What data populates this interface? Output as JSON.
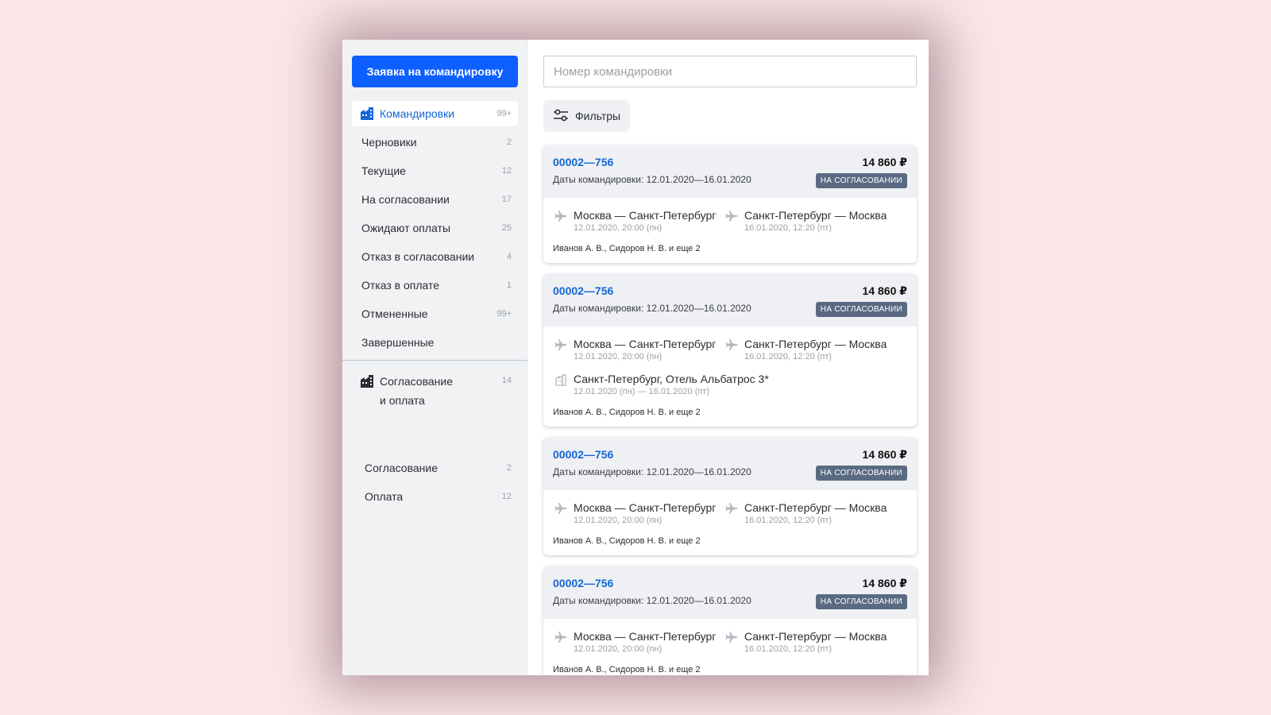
{
  "sidebar": {
    "new_trip_label": "Заявка на командировку",
    "items": [
      {
        "label": "Командировки",
        "count": "99+",
        "active": true
      },
      {
        "label": "Черновики",
        "count": "2"
      },
      {
        "label": "Текущие",
        "count": "12"
      },
      {
        "label": "На согласовании",
        "count": "17"
      },
      {
        "label": "Ожидают оплаты",
        "count": "25"
      },
      {
        "label": "Отказ в согласовании",
        "count": "4"
      },
      {
        "label": "Отказ в оплате",
        "count": "1"
      },
      {
        "label": "Отмененные",
        "count": "99+"
      },
      {
        "label": "Завершенные",
        "count": ""
      }
    ],
    "group": {
      "label_line1": "Согласование",
      "label_line2": "и оплата",
      "count": "14",
      "items": [
        {
          "label": "Согласование",
          "count": "2"
        },
        {
          "label": "Оплата",
          "count": "12"
        }
      ]
    }
  },
  "search": {
    "placeholder": "Номер командировки"
  },
  "filters_label": "Фильтры",
  "cards": [
    {
      "number": "00002—756",
      "dates": "Даты командировки: 12.01.2020—16.01.2020",
      "price": "14 860 ₽",
      "status": "НА СОГЛАСОВАНИИ",
      "flight_out": {
        "route": "Москва — Санкт-Петербург",
        "time": "12.01.2020, 20:00 (пн)"
      },
      "flight_back": {
        "route": "Санкт-Петербург — Москва",
        "time": "16.01.2020, 12:20 (пт)"
      },
      "travellers": "Иванов А. В., Сидоров Н. В. и еще 2"
    },
    {
      "number": "00002—756",
      "dates": "Даты командировки: 12.01.2020—16.01.2020",
      "price": "14 860 ₽",
      "status": "НА СОГЛАСОВАНИИ",
      "flight_out": {
        "route": "Москва — Санкт-Петербург",
        "time": "12.01.2020, 20:00 (пн)"
      },
      "flight_back": {
        "route": "Санкт-Петербург — Москва",
        "time": "16.01.2020, 12:20 (пт)"
      },
      "hotel": {
        "name": "Санкт-Петербург, Отель Альбатрос 3*",
        "dates": "12.01.2020 (пн) — 16.01.2020 (пт)"
      },
      "travellers": "Иванов А. В., Сидоров Н. В. и еще 2"
    },
    {
      "number": "00002—756",
      "dates": "Даты командировки: 12.01.2020—16.01.2020",
      "price": "14 860 ₽",
      "status": "НА СОГЛАСОВАНИИ",
      "flight_out": {
        "route": "Москва — Санкт-Петербург",
        "time": "12.01.2020, 20:00 (пн)"
      },
      "flight_back": {
        "route": "Санкт-Петербург — Москва",
        "time": "16.01.2020, 12:20 (пт)"
      },
      "travellers": "Иванов А. В., Сидоров Н. В. и еще 2"
    },
    {
      "number": "00002—756",
      "dates": "Даты командировки: 12.01.2020—16.01.2020",
      "price": "14 860 ₽",
      "status": "НА СОГЛАСОВАНИИ",
      "flight_out": {
        "route": "Москва — Санкт-Петербург",
        "time": "12.01.2020, 20:00 (пн)"
      },
      "flight_back": {
        "route": "Санкт-Петербург — Москва",
        "time": "16.01.2020, 12:20 (пт)"
      },
      "travellers": "Иванов А. В., Сидоров Н. В. и еще 2"
    }
  ],
  "colors": {
    "accent": "#0d5fff",
    "link": "#1466d6",
    "status_badge": "#5a6a82",
    "background": "#fce6e9"
  }
}
